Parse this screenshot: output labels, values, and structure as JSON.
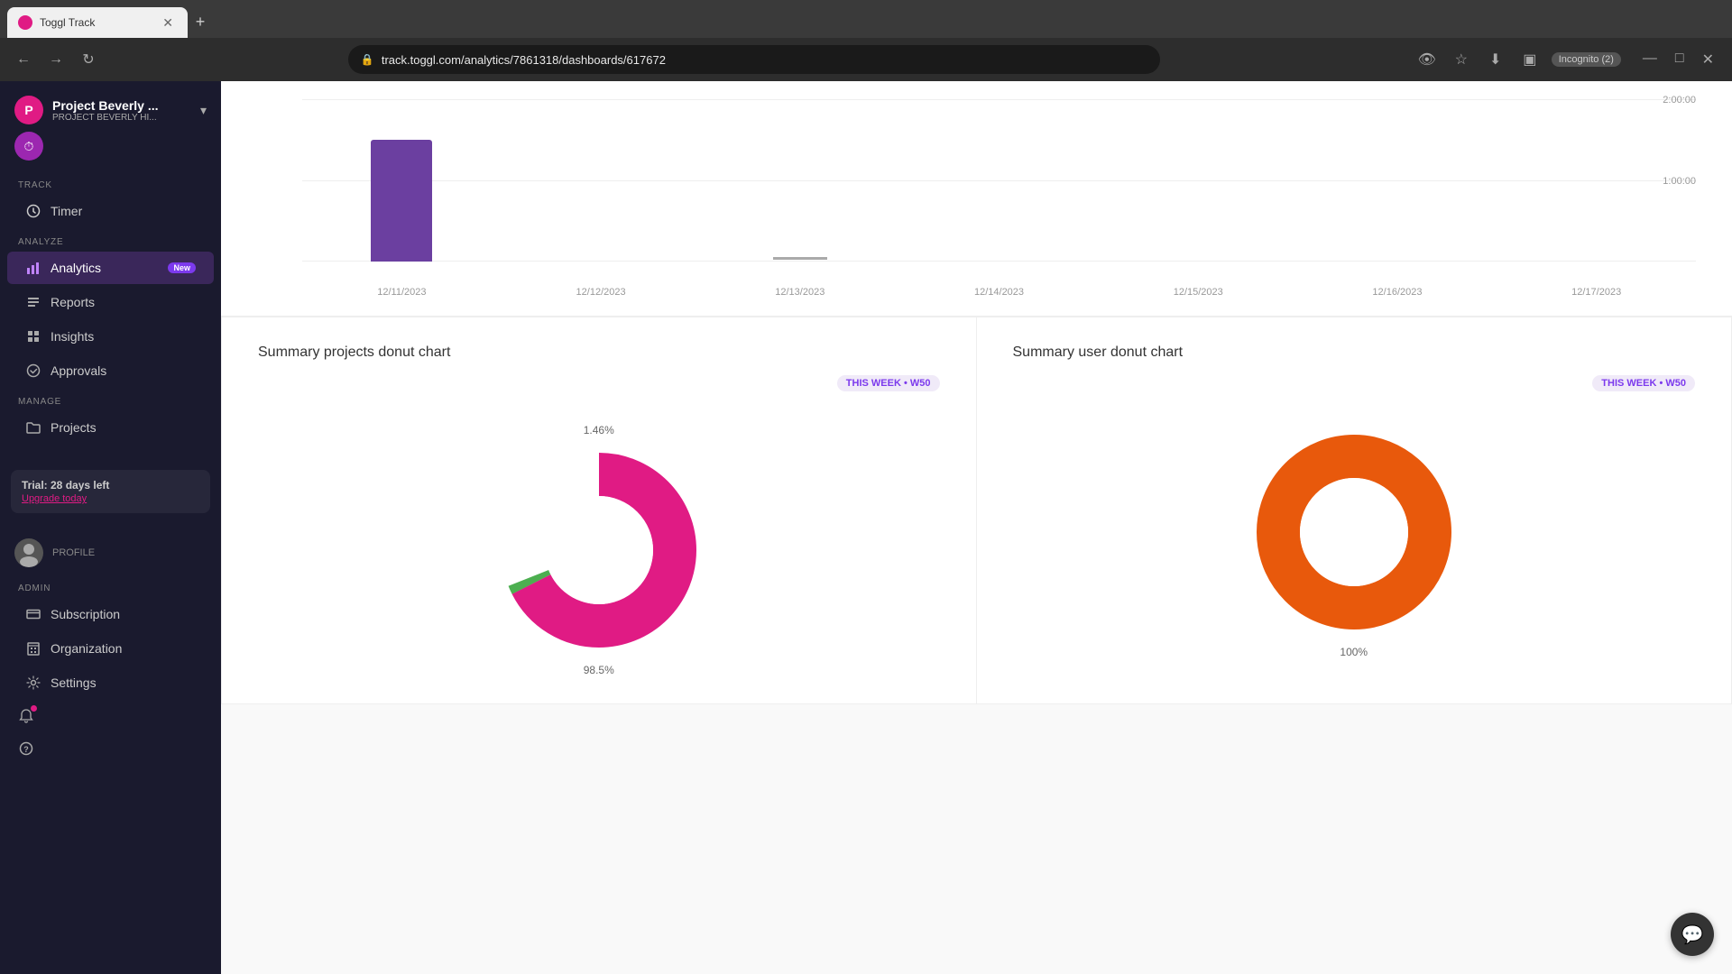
{
  "browser": {
    "tab_title": "Toggl Track",
    "tab_favicon": "T",
    "url": "track.toggl.com/analytics/7861318/dashboards/617672",
    "incognito_label": "Incognito (2)"
  },
  "sidebar": {
    "project_name": "Project Beverly ...",
    "project_sub": "PROJECT BEVERLY HI...",
    "logo_letter": "P",
    "sections": {
      "track": {
        "label": "TRACK",
        "items": [
          {
            "id": "timer",
            "label": "Timer",
            "icon": "clock"
          }
        ]
      },
      "analyze": {
        "label": "ANALYZE",
        "items": [
          {
            "id": "analytics",
            "label": "Analytics",
            "icon": "bar-chart",
            "badge": "New",
            "active": true
          },
          {
            "id": "reports",
            "label": "Reports",
            "icon": "list"
          },
          {
            "id": "insights",
            "label": "Insights",
            "icon": "grid"
          },
          {
            "id": "approvals",
            "label": "Approvals",
            "icon": "check-circle"
          }
        ]
      },
      "manage": {
        "label": "MANAGE",
        "items": [
          {
            "id": "projects",
            "label": "Projects",
            "icon": "folder"
          }
        ]
      },
      "admin": {
        "label": "ADMIN",
        "items": [
          {
            "id": "subscription",
            "label": "Subscription",
            "icon": "credit-card"
          },
          {
            "id": "organization",
            "label": "Organization",
            "icon": "building"
          },
          {
            "id": "settings",
            "label": "Settings",
            "icon": "gear"
          }
        ]
      }
    },
    "trial": {
      "text": "Trial: 28 days left",
      "upgrade_label": "Upgrade today"
    },
    "profile_label": "PROFILE",
    "help_icon": "?"
  },
  "main": {
    "bar_chart": {
      "y_labels": [
        "2:00:00",
        "1:00:00"
      ],
      "x_labels": [
        "12/11/2023",
        "12/12/2023",
        "12/13/2023",
        "12/14/2023",
        "12/15/2023",
        "12/16/2023",
        "12/17/2023"
      ],
      "bar_data": [
        {
          "date": "12/11/2023",
          "height_pct": 75,
          "has_bar": true
        },
        {
          "date": "12/12/2023",
          "height_pct": 0,
          "has_bar": false
        },
        {
          "date": "12/13/2023",
          "height_pct": 0,
          "has_bar": false,
          "has_indicator": true
        },
        {
          "date": "12/14/2023",
          "height_pct": 0,
          "has_bar": false
        },
        {
          "date": "12/15/2023",
          "height_pct": 0,
          "has_bar": false
        },
        {
          "date": "12/16/2023",
          "height_pct": 0,
          "has_bar": false
        },
        {
          "date": "12/17/2023",
          "height_pct": 0,
          "has_bar": false
        }
      ]
    },
    "donut_charts": [
      {
        "id": "projects-donut",
        "title": "Summary projects donut chart",
        "week_badge": "THIS WEEK • W50",
        "top_label": "1.46%",
        "bottom_label": "98.5%",
        "segments": [
          {
            "color": "#e01b84",
            "pct": 98.5
          },
          {
            "color": "#4caf50",
            "pct": 1.46
          }
        ]
      },
      {
        "id": "user-donut",
        "title": "Summary user donut chart",
        "week_badge": "THIS WEEK • W50",
        "top_label": "",
        "bottom_label": "100%",
        "segments": [
          {
            "color": "#e8590c",
            "pct": 100
          }
        ]
      }
    ]
  }
}
